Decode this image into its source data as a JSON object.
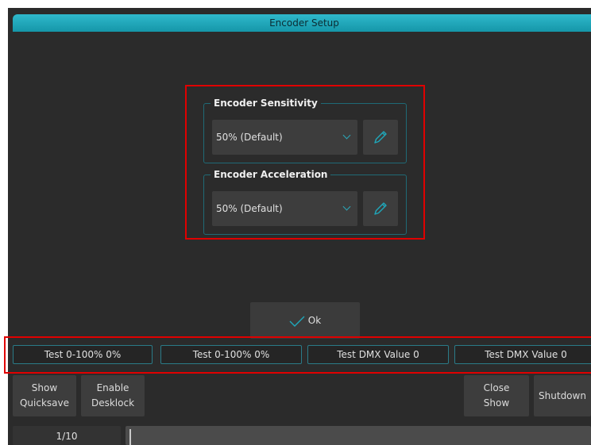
{
  "dialog": {
    "title": "Encoder Setup",
    "sensitivity": {
      "legend": "Encoder Sensitivity",
      "value": "50% (Default)",
      "edit_icon": "pencil-icon"
    },
    "acceleration": {
      "legend": "Encoder Acceleration",
      "value": "50% (Default)",
      "edit_icon": "pencil-icon"
    },
    "ok_label": "Ok",
    "ok_icon": "checkmark-icon",
    "accent_color": "#1fa8bb",
    "highlight_color": "#e00000"
  },
  "test_bar": [
    "Test 0-100% 0%",
    "Test 0-100% 0%",
    "Test DMX Value 0",
    "Test DMX Value 0"
  ],
  "function_buttons": {
    "show_quicksave": {
      "line1": "Show",
      "line2": "Quicksave"
    },
    "enable_desklock": {
      "line1": "Enable",
      "line2": "Desklock"
    },
    "close_show": {
      "line1": "Close",
      "line2": "Show"
    },
    "shutdown": {
      "label": "Shutdown"
    }
  },
  "pager": {
    "page": "1/10"
  }
}
